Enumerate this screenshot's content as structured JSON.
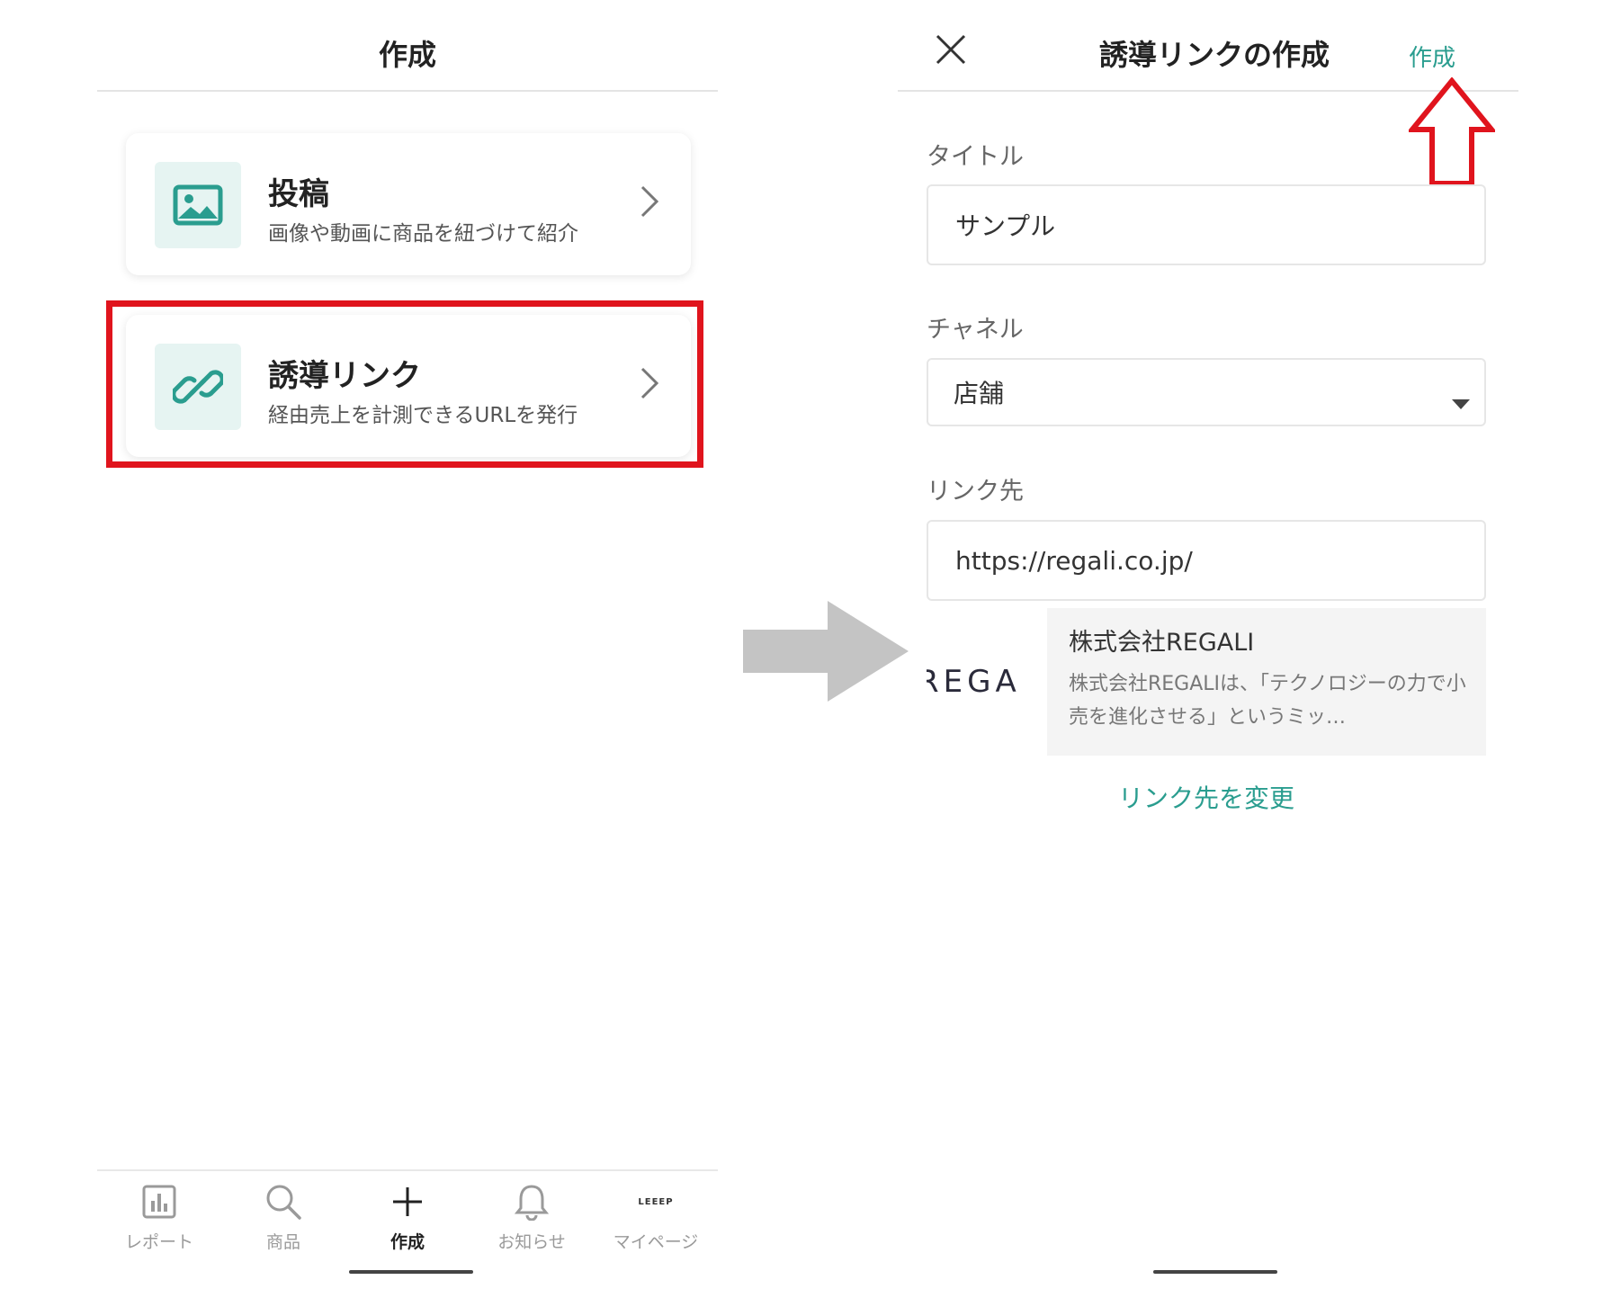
{
  "left_screen": {
    "title": "作成",
    "cards": [
      {
        "title": "投稿",
        "description": "画像や動画に商品を紐づけて紹介",
        "icon": "image-icon"
      },
      {
        "title": "誘導リンク",
        "description": "経由売上を計測できるURLを発行",
        "icon": "link-icon"
      }
    ],
    "bottom_nav": [
      {
        "label": "レポート",
        "icon": "bar-chart-icon"
      },
      {
        "label": "商品",
        "icon": "search-icon"
      },
      {
        "label": "作成",
        "icon": "plus-icon",
        "active": true
      },
      {
        "label": "お知らせ",
        "icon": "bell-icon"
      },
      {
        "label": "マイページ",
        "icon": "leeep-logo",
        "logo_text": "LEEEP"
      }
    ]
  },
  "right_screen": {
    "title": "誘導リンクの作成",
    "create_label": "作成",
    "fields": {
      "title_label": "タイトル",
      "title_value": "サンプル",
      "channel_label": "チャネル",
      "channel_value": "店舗",
      "link_label": "リンク先",
      "link_value": "https://regali.co.jp/"
    },
    "preview": {
      "logo_text": "REGA",
      "title": "株式会社REGALI",
      "description": "株式会社REGALIは、「テクノロジーの力で小売を進化させる」というミッ…"
    },
    "change_link_label": "リンク先を変更"
  },
  "colors": {
    "accent": "#2a9d8f",
    "highlight_red": "#e0141d",
    "arrow_gray": "#c4c4c4"
  }
}
